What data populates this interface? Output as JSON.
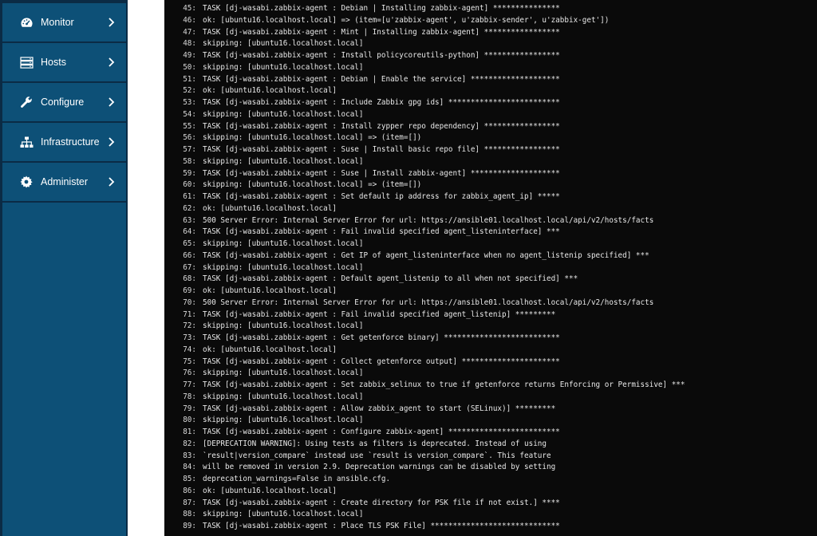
{
  "sidebar": {
    "items": [
      {
        "label": "Monitor",
        "icon": "dashboard-icon"
      },
      {
        "label": "Hosts",
        "icon": "server-icon"
      },
      {
        "label": "Configure",
        "icon": "wrench-icon"
      },
      {
        "label": "Infrastructure",
        "icon": "sitemap-icon"
      },
      {
        "label": "Administer",
        "icon": "gear-icon"
      }
    ]
  },
  "console": {
    "lines": [
      {
        "n": "45:",
        "t": "TASK [dj-wasabi.zabbix-agent : Debian | Installing zabbix-agent] ***************"
      },
      {
        "n": "46:",
        "t": "ok: [ubuntu16.localhost.local] => (item=[u'zabbix-agent', u'zabbix-sender', u'zabbix-get'])"
      },
      {
        "n": "47:",
        "t": "TASK [dj-wasabi.zabbix-agent : Mint | Installing zabbix-agent] *****************"
      },
      {
        "n": "48:",
        "t": "skipping: [ubuntu16.localhost.local]"
      },
      {
        "n": "49:",
        "t": "TASK [dj-wasabi.zabbix-agent : Install policycoreutils-python] *****************"
      },
      {
        "n": "50:",
        "t": "skipping: [ubuntu16.localhost.local]"
      },
      {
        "n": "51:",
        "t": "TASK [dj-wasabi.zabbix-agent : Debian | Enable the service] ********************"
      },
      {
        "n": "52:",
        "t": "ok: [ubuntu16.localhost.local]"
      },
      {
        "n": "53:",
        "t": "TASK [dj-wasabi.zabbix-agent : Include Zabbix gpg ids] *************************"
      },
      {
        "n": "54:",
        "t": "skipping: [ubuntu16.localhost.local]"
      },
      {
        "n": "55:",
        "t": "TASK [dj-wasabi.zabbix-agent : Install zypper repo dependency] *****************"
      },
      {
        "n": "56:",
        "t": "skipping: [ubuntu16.localhost.local] => (item=[])"
      },
      {
        "n": "57:",
        "t": "TASK [dj-wasabi.zabbix-agent : Suse | Install basic repo file] *****************"
      },
      {
        "n": "58:",
        "t": "skipping: [ubuntu16.localhost.local]"
      },
      {
        "n": "59:",
        "t": "TASK [dj-wasabi.zabbix-agent : Suse | Install zabbix-agent] ********************"
      },
      {
        "n": "60:",
        "t": "skipping: [ubuntu16.localhost.local] => (item=[])"
      },
      {
        "n": "61:",
        "t": "TASK [dj-wasabi.zabbix-agent : Set default ip address for zabbix_agent_ip] *****"
      },
      {
        "n": "62:",
        "t": "ok: [ubuntu16.localhost.local]"
      },
      {
        "n": "63:",
        "t": "500 Server Error: Internal Server Error for url: https://ansible01.localhost.local/api/v2/hosts/facts"
      },
      {
        "n": "64:",
        "t": "TASK [dj-wasabi.zabbix-agent : Fail invalid specified agent_listeninterface] ***"
      },
      {
        "n": "65:",
        "t": "skipping: [ubuntu16.localhost.local]"
      },
      {
        "n": "66:",
        "t": "TASK [dj-wasabi.zabbix-agent : Get IP of agent_listeninterface when no agent_listenip specified] ***"
      },
      {
        "n": "67:",
        "t": "skipping: [ubuntu16.localhost.local]"
      },
      {
        "n": "68:",
        "t": "TASK [dj-wasabi.zabbix-agent : Default agent_listenip to all when not specified] ***"
      },
      {
        "n": "69:",
        "t": "ok: [ubuntu16.localhost.local]"
      },
      {
        "n": "70:",
        "t": "500 Server Error: Internal Server Error for url: https://ansible01.localhost.local/api/v2/hosts/facts"
      },
      {
        "n": "71:",
        "t": "TASK [dj-wasabi.zabbix-agent : Fail invalid specified agent_listenip] *********"
      },
      {
        "n": "72:",
        "t": "skipping: [ubuntu16.localhost.local]"
      },
      {
        "n": "73:",
        "t": "TASK [dj-wasabi.zabbix-agent : Get getenforce binary] **************************"
      },
      {
        "n": "74:",
        "t": "ok: [ubuntu16.localhost.local]"
      },
      {
        "n": "75:",
        "t": "TASK [dj-wasabi.zabbix-agent : Collect getenforce output] **********************"
      },
      {
        "n": "76:",
        "t": "skipping: [ubuntu16.localhost.local]"
      },
      {
        "n": "77:",
        "t": "TASK [dj-wasabi.zabbix-agent : Set zabbix_selinux to true if getenforce returns Enforcing or Permissive] ***"
      },
      {
        "n": "78:",
        "t": "skipping: [ubuntu16.localhost.local]"
      },
      {
        "n": "79:",
        "t": "TASK [dj-wasabi.zabbix-agent : Allow zabbix_agent to start (SELinux)] *********"
      },
      {
        "n": "80:",
        "t": "skipping: [ubuntu16.localhost.local]"
      },
      {
        "n": "81:",
        "t": "TASK [dj-wasabi.zabbix-agent : Configure zabbix-agent] *************************"
      },
      {
        "n": "82:",
        "t": "[DEPRECATION WARNING]: Using tests as filters is deprecated. Instead of using"
      },
      {
        "n": "83:",
        "t": "`result|version_compare` instead use `result is version_compare`. This feature"
      },
      {
        "n": "84:",
        "t": "will be removed in version 2.9. Deprecation warnings can be disabled by setting"
      },
      {
        "n": "85:",
        "t": "deprecation_warnings=False in ansible.cfg."
      },
      {
        "n": "86:",
        "t": "ok: [ubuntu16.localhost.local]"
      },
      {
        "n": "87:",
        "t": "TASK [dj-wasabi.zabbix-agent : Create directory for PSK file if not exist.] ****"
      },
      {
        "n": "88:",
        "t": "skipping: [ubuntu16.localhost.local]"
      },
      {
        "n": "89:",
        "t": "TASK [dj-wasabi.zabbix-agent : Place TLS PSK File] *****************************"
      }
    ]
  }
}
